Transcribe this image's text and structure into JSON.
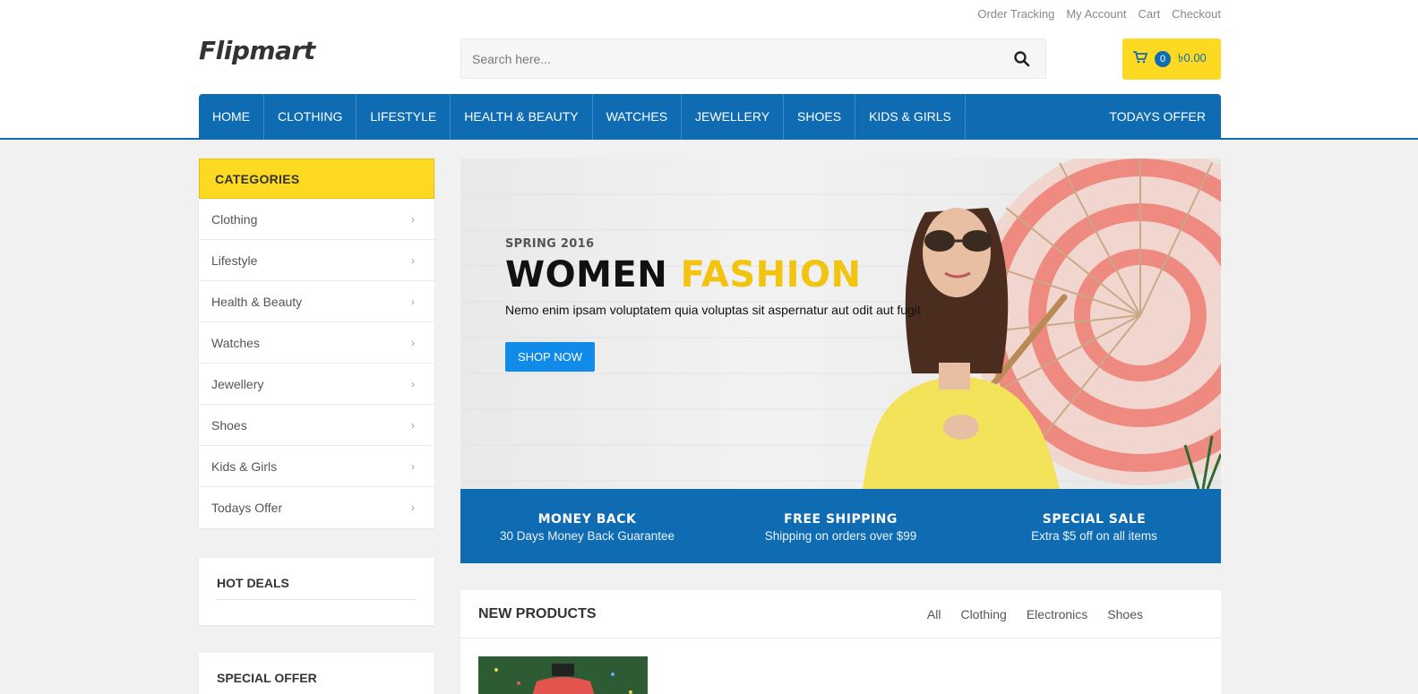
{
  "top_links": [
    "Order Tracking",
    "My Account",
    "Cart",
    "Checkout"
  ],
  "logo": "Flipmart",
  "search": {
    "placeholder": "Search here...",
    "icon": "search-icon"
  },
  "cart": {
    "count": "0",
    "total": "৳0.00",
    "icon": "cart-icon"
  },
  "nav": {
    "items": [
      "HOME",
      "CLOTHING",
      "LIFESTYLE",
      "HEALTH & BEAUTY",
      "WATCHES",
      "JEWELLERY",
      "SHOES",
      "KIDS & GIRLS"
    ],
    "right": "TODAYS OFFER"
  },
  "categories": {
    "title": "CATEGORIES",
    "items": [
      "Clothing",
      "Lifestyle",
      "Health & Beauty",
      "Watches",
      "Jewellery",
      "Shoes",
      "Kids & Girls",
      "Todays Offer"
    ]
  },
  "hot_deals": {
    "title": "HOT DEALS"
  },
  "special_offer": {
    "title": "SPECIAL OFFER"
  },
  "hero": {
    "subtitle": "SPRING 2016",
    "title_main": "WOMEN",
    "title_accent": "FASHION",
    "description": "Nemo enim ipsam voluptatem quia voluptas sit aspernatur aut odit aut fugit",
    "button": "SHOP NOW"
  },
  "features": [
    {
      "title": "MONEY BACK",
      "desc": "30 Days Money Back Guarantee"
    },
    {
      "title": "FREE SHIPPING",
      "desc": "Shipping on orders over $99"
    },
    {
      "title": "SPECIAL SALE",
      "desc": "Extra $5 off on all items"
    }
  ],
  "new_products": {
    "title": "NEW PRODUCTS",
    "tabs": [
      "All",
      "Clothing",
      "Electronics",
      "Shoes"
    ]
  },
  "colors": {
    "brand_blue": "#0f6cb2",
    "accent_yellow": "#fdd922",
    "button_blue": "#108bea"
  }
}
